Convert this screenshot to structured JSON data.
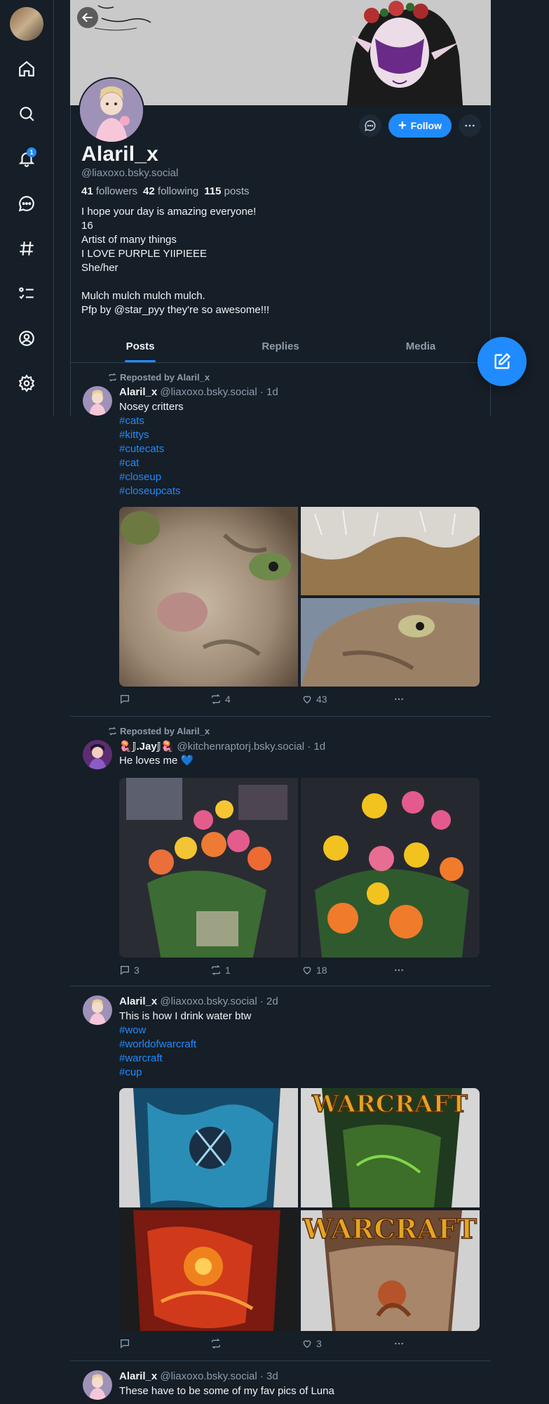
{
  "nav": {
    "notif_count": "1"
  },
  "profile": {
    "display_name": "Alaril_x",
    "handle": "@liaxoxo.bsky.social",
    "followers_count": "41",
    "followers_label": "followers",
    "following_count": "42",
    "following_label": "following",
    "posts_count": "115",
    "posts_label": "posts",
    "bio": "I hope your day is amazing everyone!\n16\nArtist of many things\nI LOVE PURPLE YIIPIEEE\nShe/her\n\nMulch mulch mulch mulch.\nPfp by @star_pyy they're so awesome!!!",
    "follow_label": "Follow"
  },
  "tabs": [
    "Posts",
    "Replies",
    "Media"
  ],
  "posts": [
    {
      "repost_label": "Reposted by Alaril_x",
      "author": "Alaril_x",
      "handle": "@liaxoxo.bsky.social",
      "time": "· 1d",
      "text": "Nosey critters",
      "tags": [
        "#cats",
        "#kittys",
        "#cutecats",
        "#cat",
        "#closeup",
        "#closeupcats"
      ],
      "replies": "",
      "reposts": "4",
      "likes": "43"
    },
    {
      "repost_label": "Reposted by Alaril_x",
      "author": "🪼𝕁.Jay𝕁🪼",
      "handle": "@kitchenraptorj.bsky.social",
      "time": "· 1d",
      "text": "He loves me 💙",
      "replies": "3",
      "reposts": "1",
      "likes": "18"
    },
    {
      "author": "Alaril_x",
      "handle": "@liaxoxo.bsky.social",
      "time": "· 2d",
      "text": "This is how I drink water btw",
      "tags": [
        "#wow",
        "#worldofwarcraft",
        "#warcraft",
        "#cup"
      ],
      "replies": "",
      "reposts": "",
      "likes": "3",
      "img_labels": [
        "WARCRAFT",
        "WARCRAFT"
      ]
    },
    {
      "author": "Alaril_x",
      "handle": "@liaxoxo.bsky.social",
      "time": "· 3d",
      "text": "These have to be some of my fav pics of Luna"
    }
  ]
}
